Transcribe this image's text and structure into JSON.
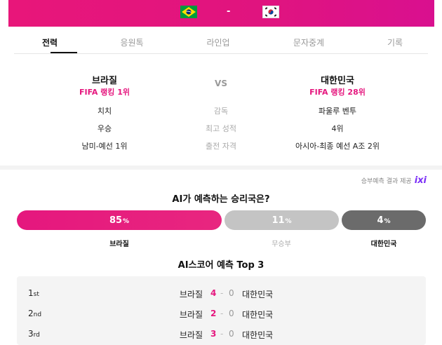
{
  "colors": {
    "accent": "#e5177e",
    "win_bar": "#e5177e",
    "draw_bar": "#c4c4c4",
    "lose_bar": "#6b6b6b"
  },
  "header": {
    "home_flag": "brazil-flag",
    "away_flag": "korea-flag",
    "separator": "-"
  },
  "tabs": [
    "전력",
    "응원톡",
    "라인업",
    "문자중계",
    "기록"
  ],
  "active_tab": 0,
  "home": {
    "name": "브라질",
    "rank": "FIFA 랭킹 1위",
    "coach": "치치",
    "best": "우승",
    "qualify": "남미-예선 1위"
  },
  "away": {
    "name": "대한민국",
    "rank": "FIFA 랭킹 28위",
    "coach": "파울루 벤투",
    "best": "4위",
    "qualify": "아시아-최종 예선 A조 2위"
  },
  "vs_label": "VS",
  "row_labels": {
    "coach": "감독",
    "best": "최고 성적",
    "qualify": "출전 자격"
  },
  "prediction": {
    "provider_text": "승부예측 결과 제공",
    "provider_logo": "ixi",
    "title": "AI가 예측하는 승리국은?",
    "win": {
      "value": "85",
      "unit": "%",
      "label": "브라질",
      "fraction": 0.85
    },
    "draw": {
      "value": "11",
      "unit": "%",
      "label": "무승부",
      "fraction": 0.11
    },
    "lose": {
      "value": "4",
      "unit": "%",
      "label": "대한민국",
      "fraction": 0.04
    }
  },
  "score_prediction": {
    "title": "AI스코어 예측 Top 3",
    "rows": [
      {
        "rank": "1",
        "suffix": "st",
        "home": "브라질",
        "home_score": "4",
        "sep": "-",
        "away_score": "0",
        "away": "대한민국"
      },
      {
        "rank": "2",
        "suffix": "nd",
        "home": "브라질",
        "home_score": "2",
        "sep": "-",
        "away_score": "0",
        "away": "대한민국"
      },
      {
        "rank": "3",
        "suffix": "rd",
        "home": "브라질",
        "home_score": "3",
        "sep": "-",
        "away_score": "0",
        "away": "대한민국"
      }
    ]
  }
}
